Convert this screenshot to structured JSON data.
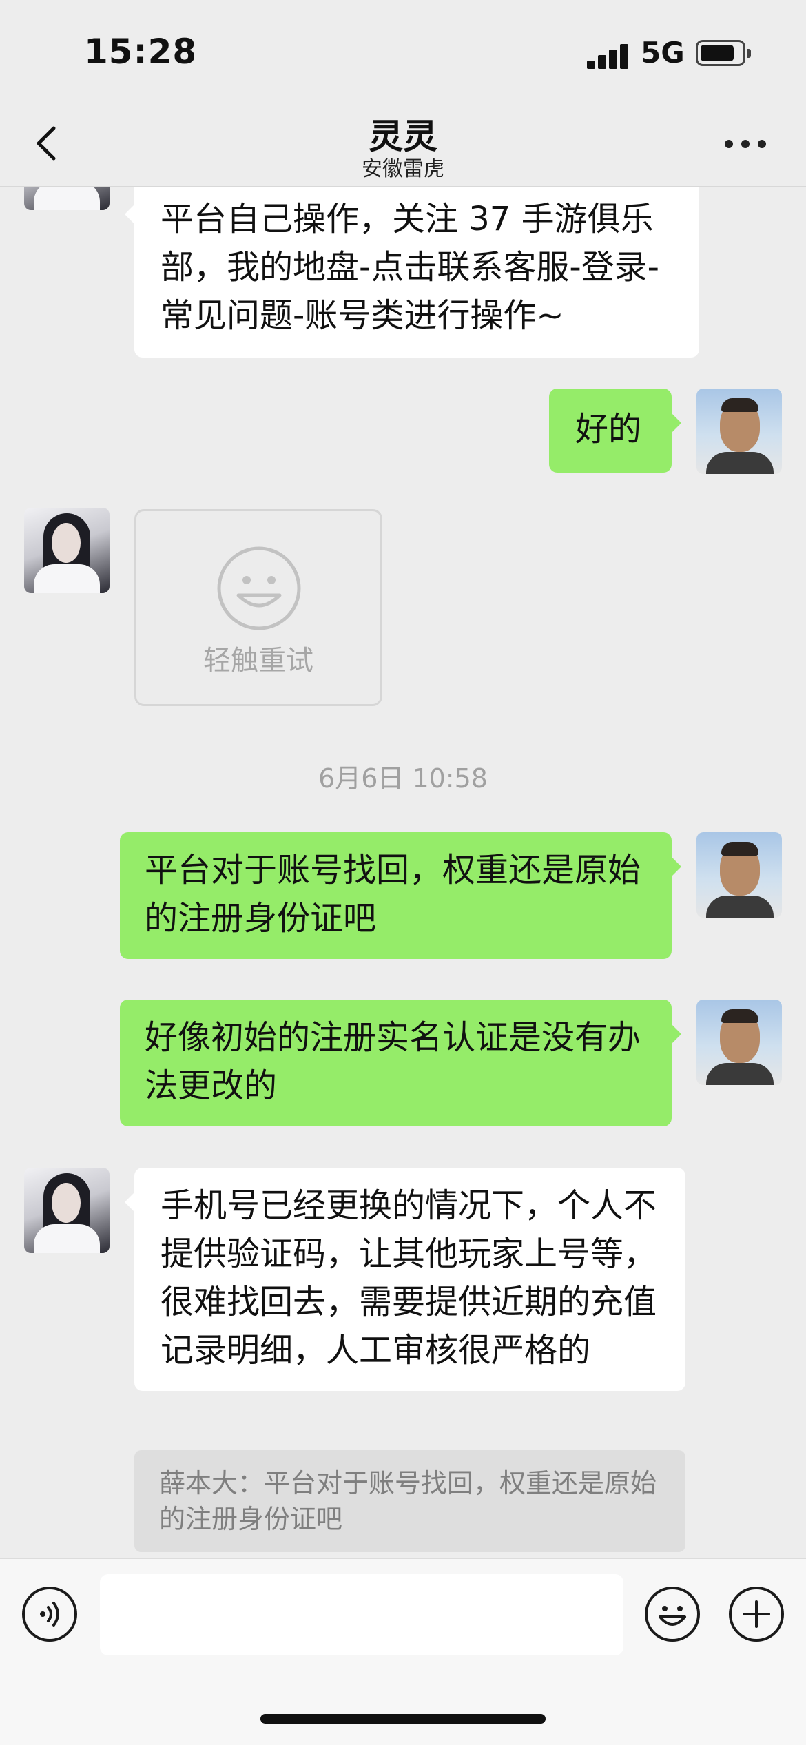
{
  "status_bar": {
    "time": "15:28",
    "network": "5G"
  },
  "header": {
    "title": "灵灵",
    "subtitle": "安徽雷虎"
  },
  "messages": [
    {
      "side": "left",
      "type": "text",
      "text": "平台自己操作，关注 37 手游俱乐部，我的地盘-点击联系客服-登录-常见问题-账号类进行操作~"
    },
    {
      "side": "right",
      "type": "text",
      "text": "好的"
    },
    {
      "side": "left",
      "type": "failed-sticker",
      "text": "轻触重试"
    },
    {
      "side": "right",
      "type": "text",
      "text": "平台对于账号找回，权重还是原始的注册身份证吧"
    },
    {
      "side": "right",
      "type": "text",
      "text": "好像初始的注册实名认证是没有办法更改的"
    },
    {
      "side": "left",
      "type": "text",
      "text": "手机号已经更换的情况下，个人不提供验证码，让其他玩家上号等，很难找回去，需要提供近期的充值记录明细，人工审核很严格的"
    }
  ],
  "timestamp": "6月6日 10:58",
  "quote": {
    "text": "薛本大：平台对于账号找回，权重还是原始的注册身份证吧"
  },
  "input_bar": {
    "placeholder": "",
    "icons": [
      "voice-icon",
      "emoji-icon",
      "plus-icon"
    ]
  },
  "colors": {
    "background": "#ededed",
    "outgoing_bubble": "#95ec69",
    "incoming_bubble": "#ffffff"
  }
}
